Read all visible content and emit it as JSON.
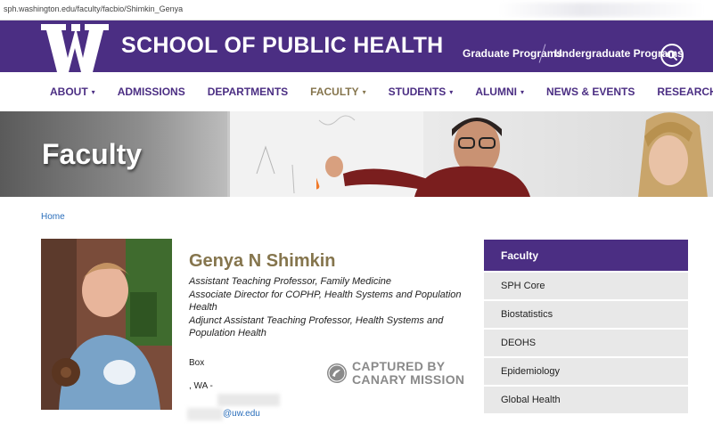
{
  "browser": {
    "url": "sph.washington.edu/faculty/facbio/Shimkin_Genya"
  },
  "header": {
    "logo_letter": "W",
    "site_title": "SCHOOL OF PUBLIC HEALTH",
    "links": [
      "Graduate Programs",
      "Undergraduate Programs"
    ],
    "search_icon": "search-icon"
  },
  "nav": {
    "items": [
      {
        "label": "ABOUT",
        "dropdown": true
      },
      {
        "label": "ADMISSIONS",
        "dropdown": false
      },
      {
        "label": "DEPARTMENTS",
        "dropdown": false
      },
      {
        "label": "FACULTY",
        "dropdown": true
      },
      {
        "label": "STUDENTS",
        "dropdown": true
      },
      {
        "label": "ALUMNI",
        "dropdown": true
      },
      {
        "label": "NEWS & EVENTS",
        "dropdown": false
      },
      {
        "label": "RESEARCH",
        "dropdown": false
      }
    ],
    "active": "FACULTY",
    "caret": "▾"
  },
  "hero": {
    "title": "Faculty"
  },
  "breadcrumb": {
    "home": "Home"
  },
  "profile": {
    "name": "Genya N Shimkin",
    "titles": [
      "Assistant Teaching Professor, Family Medicine",
      "Associate Director for COPHP, Health Systems and Population Health",
      "Adjunct Assistant Teaching Professor, Health Systems and Population Health"
    ],
    "box": "Box",
    "city_state": ", WA -",
    "email_suffix": "@uw.edu"
  },
  "watermark": {
    "line1": "CAPTURED BY",
    "line2": "CANARY MISSION"
  },
  "sidebar": {
    "heading": "Faculty",
    "items": [
      "SPH Core",
      "Biostatistics",
      "DEOHS",
      "Epidemiology",
      "Global Health"
    ]
  },
  "colors": {
    "uw_purple": "#4b2e83",
    "uw_gold": "#85754d",
    "link_blue": "#2a6ebb"
  }
}
